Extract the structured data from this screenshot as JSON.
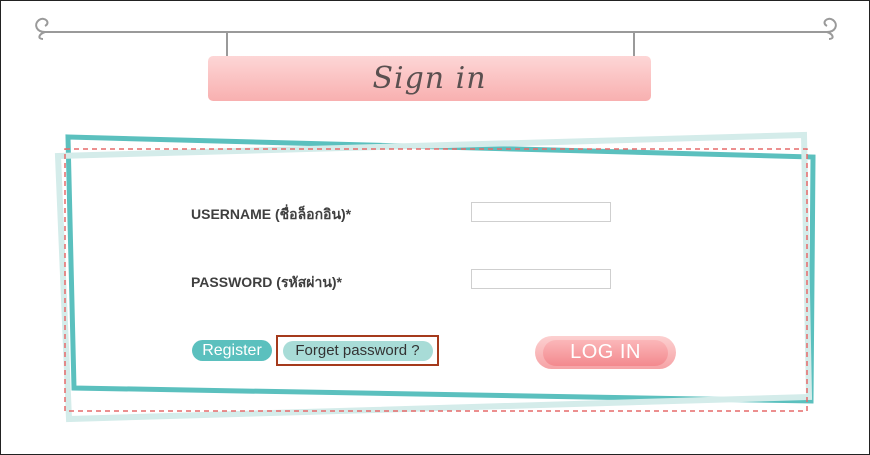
{
  "header": {
    "title": "Sign in"
  },
  "form": {
    "username_label": "USERNAME (ชื่อล็อกอิน)*",
    "username_value": "",
    "password_label": "PASSWORD (รหัสผ่าน)*",
    "password_value": ""
  },
  "actions": {
    "register_label": "Register",
    "forgot_label": "Forget password ?",
    "login_label": "LOG IN"
  },
  "colors": {
    "teal": "#5bc0be",
    "light_teal": "#a8dcd7",
    "pink": "#f6a3a6",
    "dashed_red": "#e66a6a",
    "highlight_border": "#a53a1c"
  }
}
